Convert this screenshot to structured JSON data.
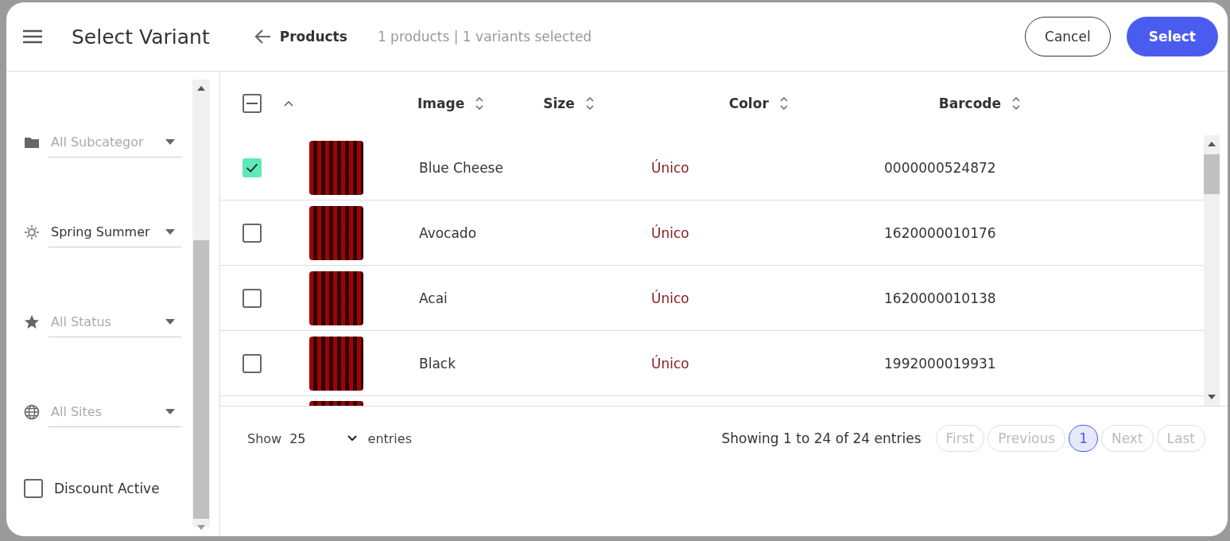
{
  "header": {
    "title": "Select Variant",
    "back_label": "Products",
    "summary": "1 products | 1 variants selected",
    "buttons": [
      {
        "label": "Cancel",
        "kind": "secondary"
      },
      {
        "label": "Select",
        "kind": "primary"
      }
    ]
  },
  "filters": [
    {
      "kind": "subcategory",
      "text": "All Subcategor",
      "is_value": false
    },
    {
      "kind": "season",
      "text": "Spring Summer",
      "is_value": true
    },
    {
      "kind": "status",
      "text": "All Status",
      "is_value": false
    },
    {
      "kind": "site",
      "text": "All Sites",
      "is_value": false
    }
  ],
  "discount": {
    "label": "Discount Active",
    "checked": false
  },
  "table": {
    "select_all": {
      "indeterminate": true
    },
    "columns": [
      "Image",
      "Size",
      "Color",
      "Barcode"
    ],
    "rows": [
      {
        "selected": true,
        "name": "Blue Cheese",
        "size": "Único",
        "barcode": "0000000524872"
      },
      {
        "selected": false,
        "name": "Avocado",
        "size": "Único",
        "barcode": "1620000010176"
      },
      {
        "selected": false,
        "name": "Acai",
        "size": "Único",
        "barcode": "1620000010138"
      },
      {
        "selected": false,
        "name": "Black",
        "size": "Único",
        "barcode": "1992000019931"
      }
    ]
  },
  "footer": {
    "show_label": "Show",
    "page_size": "25",
    "entries_label": "entries",
    "info": "Showing 1 to 24 of 24 entries",
    "pages": [
      {
        "label": "First",
        "selected": false
      },
      {
        "label": "Previous",
        "selected": false
      },
      {
        "label": "1",
        "selected": true
      },
      {
        "label": "Next",
        "selected": false
      },
      {
        "label": "Last",
        "selected": false
      }
    ]
  }
}
